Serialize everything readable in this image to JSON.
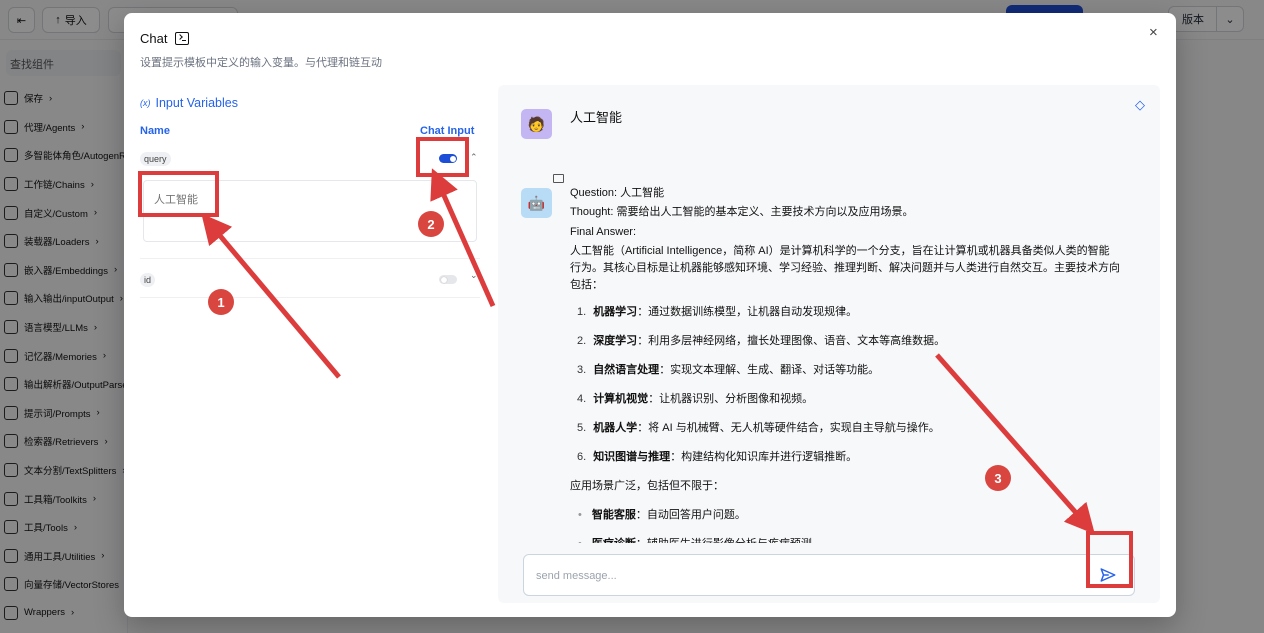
{
  "background": {
    "toolbar": {
      "back_label": "",
      "import_label": "导入",
      "version_label": "版本"
    },
    "search_placeholder": "查找组件",
    "sidebar_items": [
      "保存",
      "代理/Agents",
      "多智能体角色/AutogenR",
      "工作链/Chains",
      "自定义/Custom",
      "装载器/Loaders",
      "嵌入器/Embeddings",
      "输入输出/inputOutput",
      "语言模型/LLMs",
      "记忆器/Memories",
      "输出解析器/OutputParse",
      "提示词/Prompts",
      "检索器/Retrievers",
      "文本分割/TextSplitters",
      "工具箱/Toolkits",
      "工具/Tools",
      "通用工具/Utilities",
      "向量存储/VectorStores",
      "Wrappers"
    ]
  },
  "modal": {
    "title": "Chat",
    "subtitle": "设置提示模板中定义的输入变量。与代理和链互动",
    "close_label": "×",
    "input_variables": {
      "title": "Input Variables",
      "col_name": "Name",
      "col_chat_input": "Chat Input",
      "variables": [
        {
          "name": "query",
          "chat_input": true,
          "value": "人工智能"
        },
        {
          "name": "id",
          "chat_input": false
        }
      ]
    },
    "chat": {
      "user_message": "人工智能",
      "bot_question": "Question: 人工智能",
      "bot_thought": "Thought: 需要给出人工智能的基本定义、主要技术方向以及应用场景。",
      "bot_final": "Final Answer:",
      "bot_intro": "人工智能（Artificial Intelligence，简称 AI）是计算机科学的一个分支，旨在让计算机或机器具备类似人类的智能行为。其核心目标是让机器能够感知环境、学习经验、推理判断、解决问题并与人类进行自然交互。主要技术方向包括：",
      "bot_list": [
        {
          "num": "1.",
          "title": "机器学习",
          "desc": "：通过数据训练模型，让机器自动发现规律。"
        },
        {
          "num": "2.",
          "title": "深度学习",
          "desc": "：利用多层神经网络，擅长处理图像、语音、文本等高维数据。"
        },
        {
          "num": "3.",
          "title": "自然语言处理",
          "desc": "：实现文本理解、生成、翻译、对话等功能。"
        },
        {
          "num": "4.",
          "title": "计算机视觉",
          "desc": "：让机器识别、分析图像和视频。"
        },
        {
          "num": "5.",
          "title": "机器人学",
          "desc": "：将 AI 与机械臂、无人机等硬件结合，实现自主导航与操作。"
        },
        {
          "num": "6.",
          "title": "知识图谱与推理",
          "desc": "：构建结构化知识库并进行逻辑推断。"
        }
      ],
      "bot_scenarios": "应用场景广泛，包括但不限于：",
      "bot_bullets": [
        {
          "title": "智能客服",
          "desc": "：自动回答用户问题。"
        },
        {
          "title": "医疗诊断",
          "desc": "：辅助医生进行影像分析与疾病预测。"
        }
      ],
      "input_placeholder": "send message..."
    }
  },
  "annotations": [
    "1",
    "2",
    "3"
  ],
  "colors": {
    "accent": "#2563eb",
    "annotation_red": "#dc3c3c",
    "toggle_on": "#1d4ed8"
  }
}
